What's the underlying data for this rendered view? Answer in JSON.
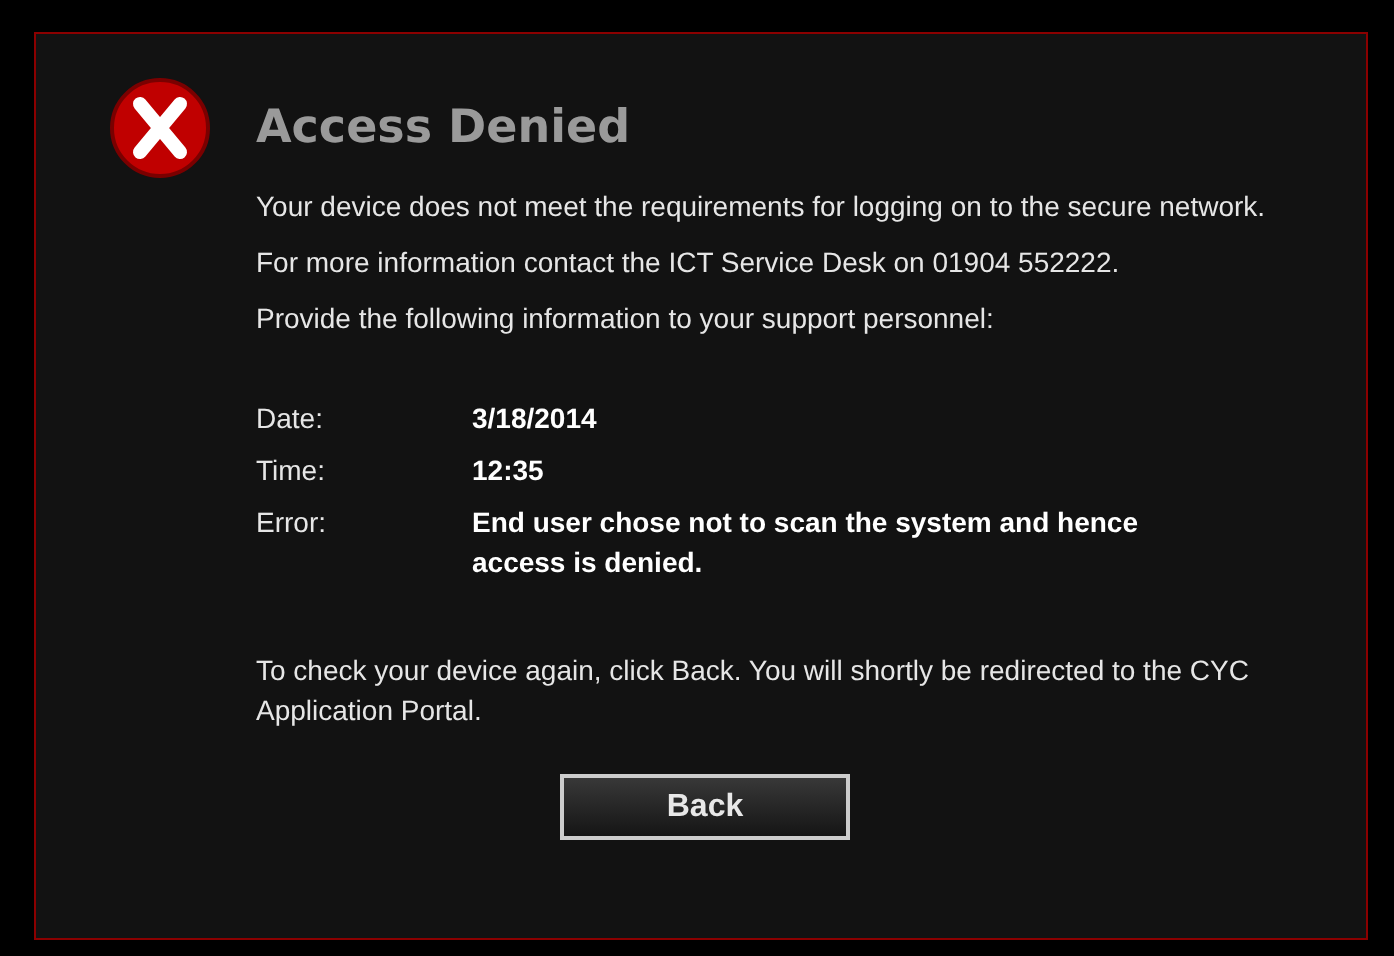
{
  "dialog": {
    "title": "Access Denied",
    "paragraphs": [
      "Your device does not meet the requirements for logging on to the secure network.",
      "For more information contact the ICT Service Desk on 01904 552222.",
      "Provide the following information to your support personnel:"
    ],
    "details": [
      {
        "label": "Date:",
        "value": "3/18/2014"
      },
      {
        "label": "Time:",
        "value": "12:35"
      },
      {
        "label": "Error:",
        "value": "End user chose not to scan the system and hence access is denied."
      }
    ],
    "footer": "To check your device again, click Back. You will shortly be redirected to the CYC Application Portal.",
    "button": "Back"
  }
}
